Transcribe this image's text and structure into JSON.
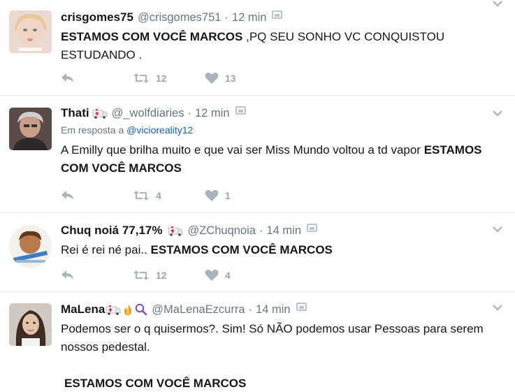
{
  "colors": {
    "link": "#1b5fa8",
    "meta": "#657786",
    "action": "#a6b4be",
    "divider": "#e6ecf0"
  },
  "tweets": [
    {
      "name": "crisgomes75",
      "handle": "@crisgomes751",
      "sep": "·",
      "time": "12 min",
      "text_bold": "ESTAMOS COM VOCÊ MARCOS",
      "text_rest": " ,PQ SEU SONHO VC CONQUISTOU ESTUDANDO .",
      "retweets": "12",
      "likes": "13"
    },
    {
      "name": "Thati",
      "handle": "@_wolfdiaries",
      "sep": "·",
      "time": "12 min",
      "reply_prefix": "Em resposta a",
      "reply_handle": "@vicioreality12",
      "text_rest": "A Emilly que brilha muito e que vai ser Miss Mundo voltou a td vapor ",
      "text_bold": "ESTAMOS COM VOCÊ MARCOS",
      "retweets": "4",
      "likes": "1"
    },
    {
      "name": "Chuq noiá 77,17%",
      "handle": "@ZChuqnoia",
      "sep": "·",
      "time": "14 min",
      "text_rest": "Rei é rei né pai.. ",
      "text_bold": "ESTAMOS COM VOCÊ MARCOS",
      "retweets": "12",
      "likes": "4"
    },
    {
      "name": "MaLena",
      "handle": "@MaLenaEzcurra",
      "sep": "·",
      "time": "14 min",
      "text_rest": "Podemos ser o q quisermos?. Sim! Só NÃO podemos usar Pessoas para serem nossos pedestal.",
      "text_bold": "ESTAMOS COM VOCÊ MARCOS"
    }
  ]
}
